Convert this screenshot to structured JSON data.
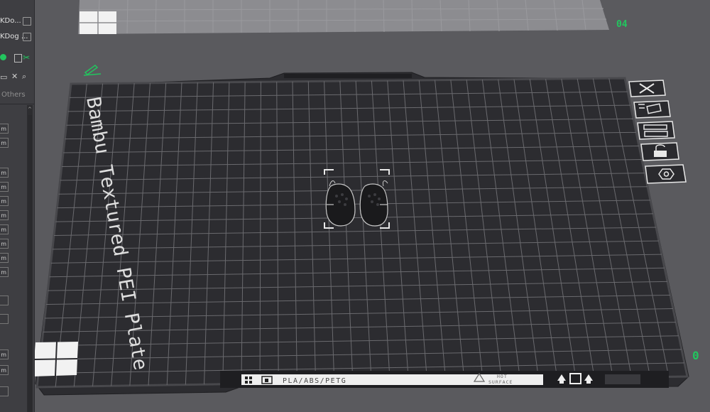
{
  "left_panel": {
    "files": [
      {
        "name": "KDo..."
      },
      {
        "name": "KDog ..."
      }
    ],
    "others_label": "Others",
    "field_suffix": "m"
  },
  "plate": {
    "label": "Bambu Textured PEI Plate",
    "bottom_bar": {
      "filament_types": "PLA/ABS/PETG",
      "warning_line1": "HOT",
      "warning_line2": "SURFACE"
    },
    "number_top": "04",
    "number_right": "0"
  },
  "side_toolbar": [
    {
      "name": "delete-plate-icon"
    },
    {
      "name": "auto-orient-icon"
    },
    {
      "name": "arrange-icon"
    },
    {
      "name": "lock-plate-icon"
    },
    {
      "name": "plate-settings-icon"
    }
  ],
  "colors": {
    "background": "#5a5a5e",
    "plate": "#2c2c30",
    "grid": "#6a6a6e",
    "accent_green": "#22c55e",
    "panel": "#3e3e42"
  }
}
